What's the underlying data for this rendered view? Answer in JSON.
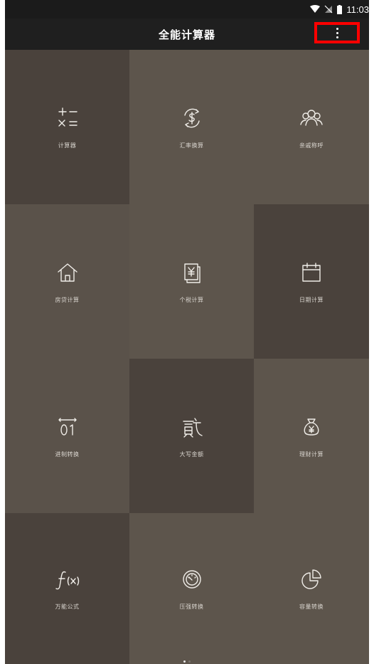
{
  "status": {
    "time": "11:03"
  },
  "appbar": {
    "title": "全能计算器"
  },
  "tiles": [
    {
      "label": "计算器",
      "icon": "calculator-icon"
    },
    {
      "label": "汇率换算",
      "icon": "currency-exchange-icon"
    },
    {
      "label": "亲戚称呼",
      "icon": "relatives-icon"
    },
    {
      "label": "房贷计算",
      "icon": "house-icon"
    },
    {
      "label": "个税计算",
      "icon": "tax-document-icon"
    },
    {
      "label": "日期计算",
      "icon": "calendar-icon"
    },
    {
      "label": "进制转换",
      "icon": "binary-icon"
    },
    {
      "label": "大写金额",
      "icon": "capital-amount-icon"
    },
    {
      "label": "理财计算",
      "icon": "money-bag-icon"
    },
    {
      "label": "万能公式",
      "icon": "formula-icon"
    },
    {
      "label": "压强转换",
      "icon": "pressure-gauge-icon"
    },
    {
      "label": "容量转换",
      "icon": "pie-chart-icon"
    }
  ],
  "colors": {
    "highlight_border": "#ff0000",
    "tile_dark": "#4a423c",
    "tile_mid": "#5a524a"
  }
}
